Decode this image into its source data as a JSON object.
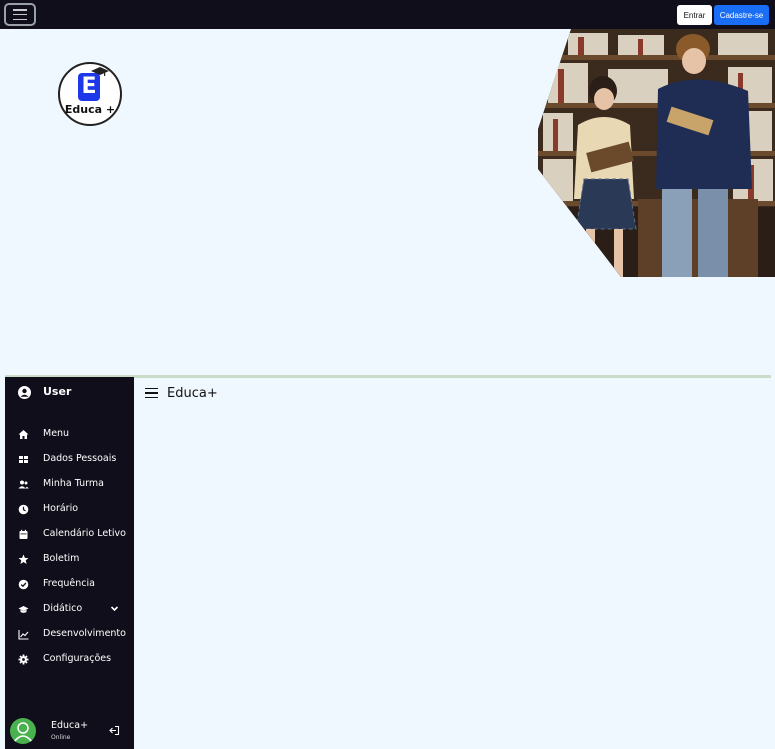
{
  "navbar": {
    "toggle_icon": "hamburger-icon",
    "login_label": "Entrar",
    "signup_label": "Cadastre-se",
    "signup_color": "#1a6ef5"
  },
  "hero": {
    "logo_letter": "E",
    "logo_text": "Educa +",
    "image": "students-reading-in-library"
  },
  "sidebar": {
    "header": {
      "icon": "user-circle-icon",
      "label": "User"
    },
    "items": [
      {
        "label": "Menu",
        "icon": "home-icon"
      },
      {
        "label": "Dados Pessoais",
        "icon": "grid-icon"
      },
      {
        "label": "Minha Turma",
        "icon": "users-icon"
      },
      {
        "label": "Horário",
        "icon": "clock-icon"
      },
      {
        "label": "Calendário Letivo",
        "icon": "calendar-icon"
      },
      {
        "label": "Boletim",
        "icon": "star-icon"
      },
      {
        "label": "Frequência",
        "icon": "check-circle-icon"
      },
      {
        "label": "Didático",
        "icon": "graduation-cap-icon",
        "expandable": true
      },
      {
        "label": "Desenvolvimento",
        "icon": "line-chart-icon"
      },
      {
        "label": "Configurações",
        "icon": "gear-icon"
      }
    ],
    "footer": {
      "name": "Educa+",
      "status": "Online",
      "logout_icon": "logout-icon"
    }
  },
  "main": {
    "menu_icon": "hamburger-icon",
    "title": "Educa+"
  }
}
